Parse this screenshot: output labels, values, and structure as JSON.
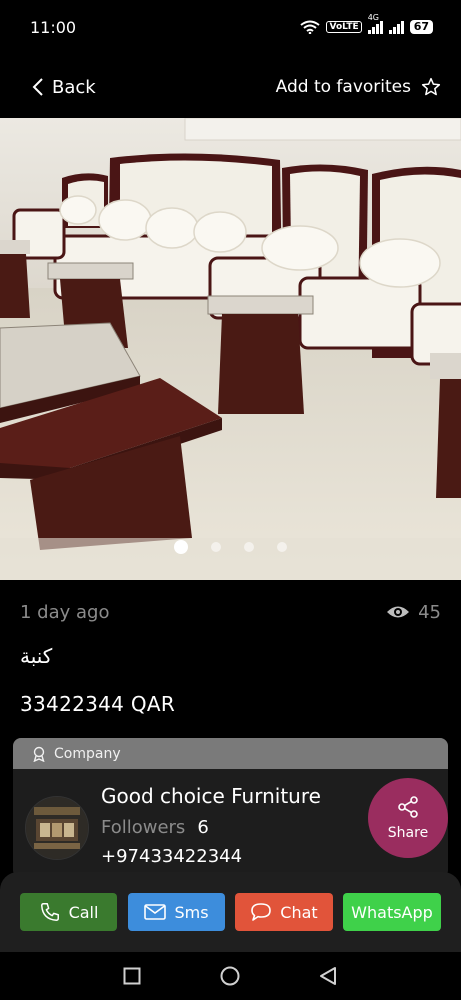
{
  "status": {
    "time": "11:00",
    "volte": "VoLTE",
    "network": "4G",
    "battery": "67"
  },
  "topbar": {
    "back_label": "Back",
    "favorites_label": "Add to favorites"
  },
  "gallery": {
    "image_count": 4,
    "active_index": 0
  },
  "listing": {
    "posted": "1 day ago",
    "views": "45",
    "title": "كنبة",
    "price": "33422344 QAR"
  },
  "seller": {
    "type_label": "Company",
    "name": "Good choice Furniture",
    "followers_label": "Followers",
    "followers_count": "6",
    "phone": "+97433422344",
    "share_label": "Share"
  },
  "actions": {
    "call": "Call",
    "sms": "Sms",
    "chat": "Chat",
    "whatsapp": "WhatsApp"
  },
  "colors": {
    "call": "#3a7a2e",
    "sms": "#3d8ddc",
    "chat": "#e1543a",
    "whatsapp": "#3fd14a",
    "share": "#9a2d5f"
  }
}
